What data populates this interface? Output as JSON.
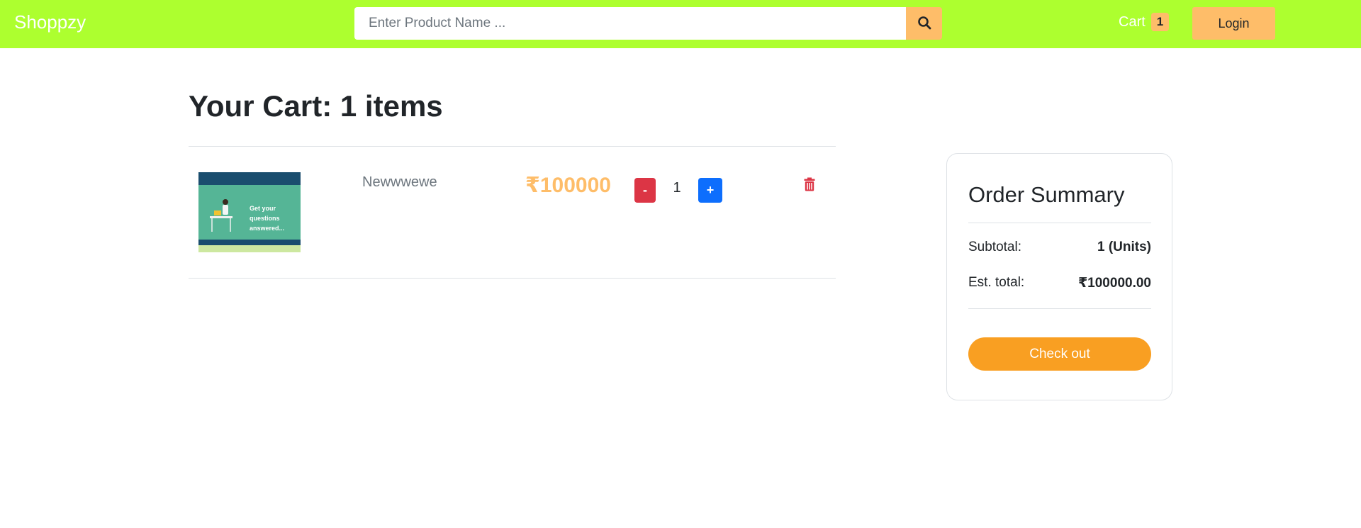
{
  "header": {
    "brand": "Shoppzy",
    "search_placeholder": "Enter Product Name ...",
    "cart_label": "Cart",
    "cart_count": "1",
    "login_label": "Login",
    "accent_color": "#adff2f",
    "button_color": "#febd69"
  },
  "cart": {
    "heading_prefix": "Your Cart: ",
    "heading_count": "1 items",
    "items": [
      {
        "name": "Newwwewe",
        "price": "₹100000",
        "quantity": "1",
        "decrease_label": "-",
        "increase_label": "+",
        "thumbnail_text_1": "Get your questions",
        "thumbnail_text_2": "answered..."
      }
    ]
  },
  "summary": {
    "title": "Order Summary",
    "subtotal_label": "Subtotal:",
    "subtotal_value": "1 (Units)",
    "total_label": "Est. total:",
    "total_value": "₹100000.00",
    "checkout_label": "Check out"
  },
  "icons": {
    "search": "search-icon",
    "delete": "trash-icon"
  }
}
